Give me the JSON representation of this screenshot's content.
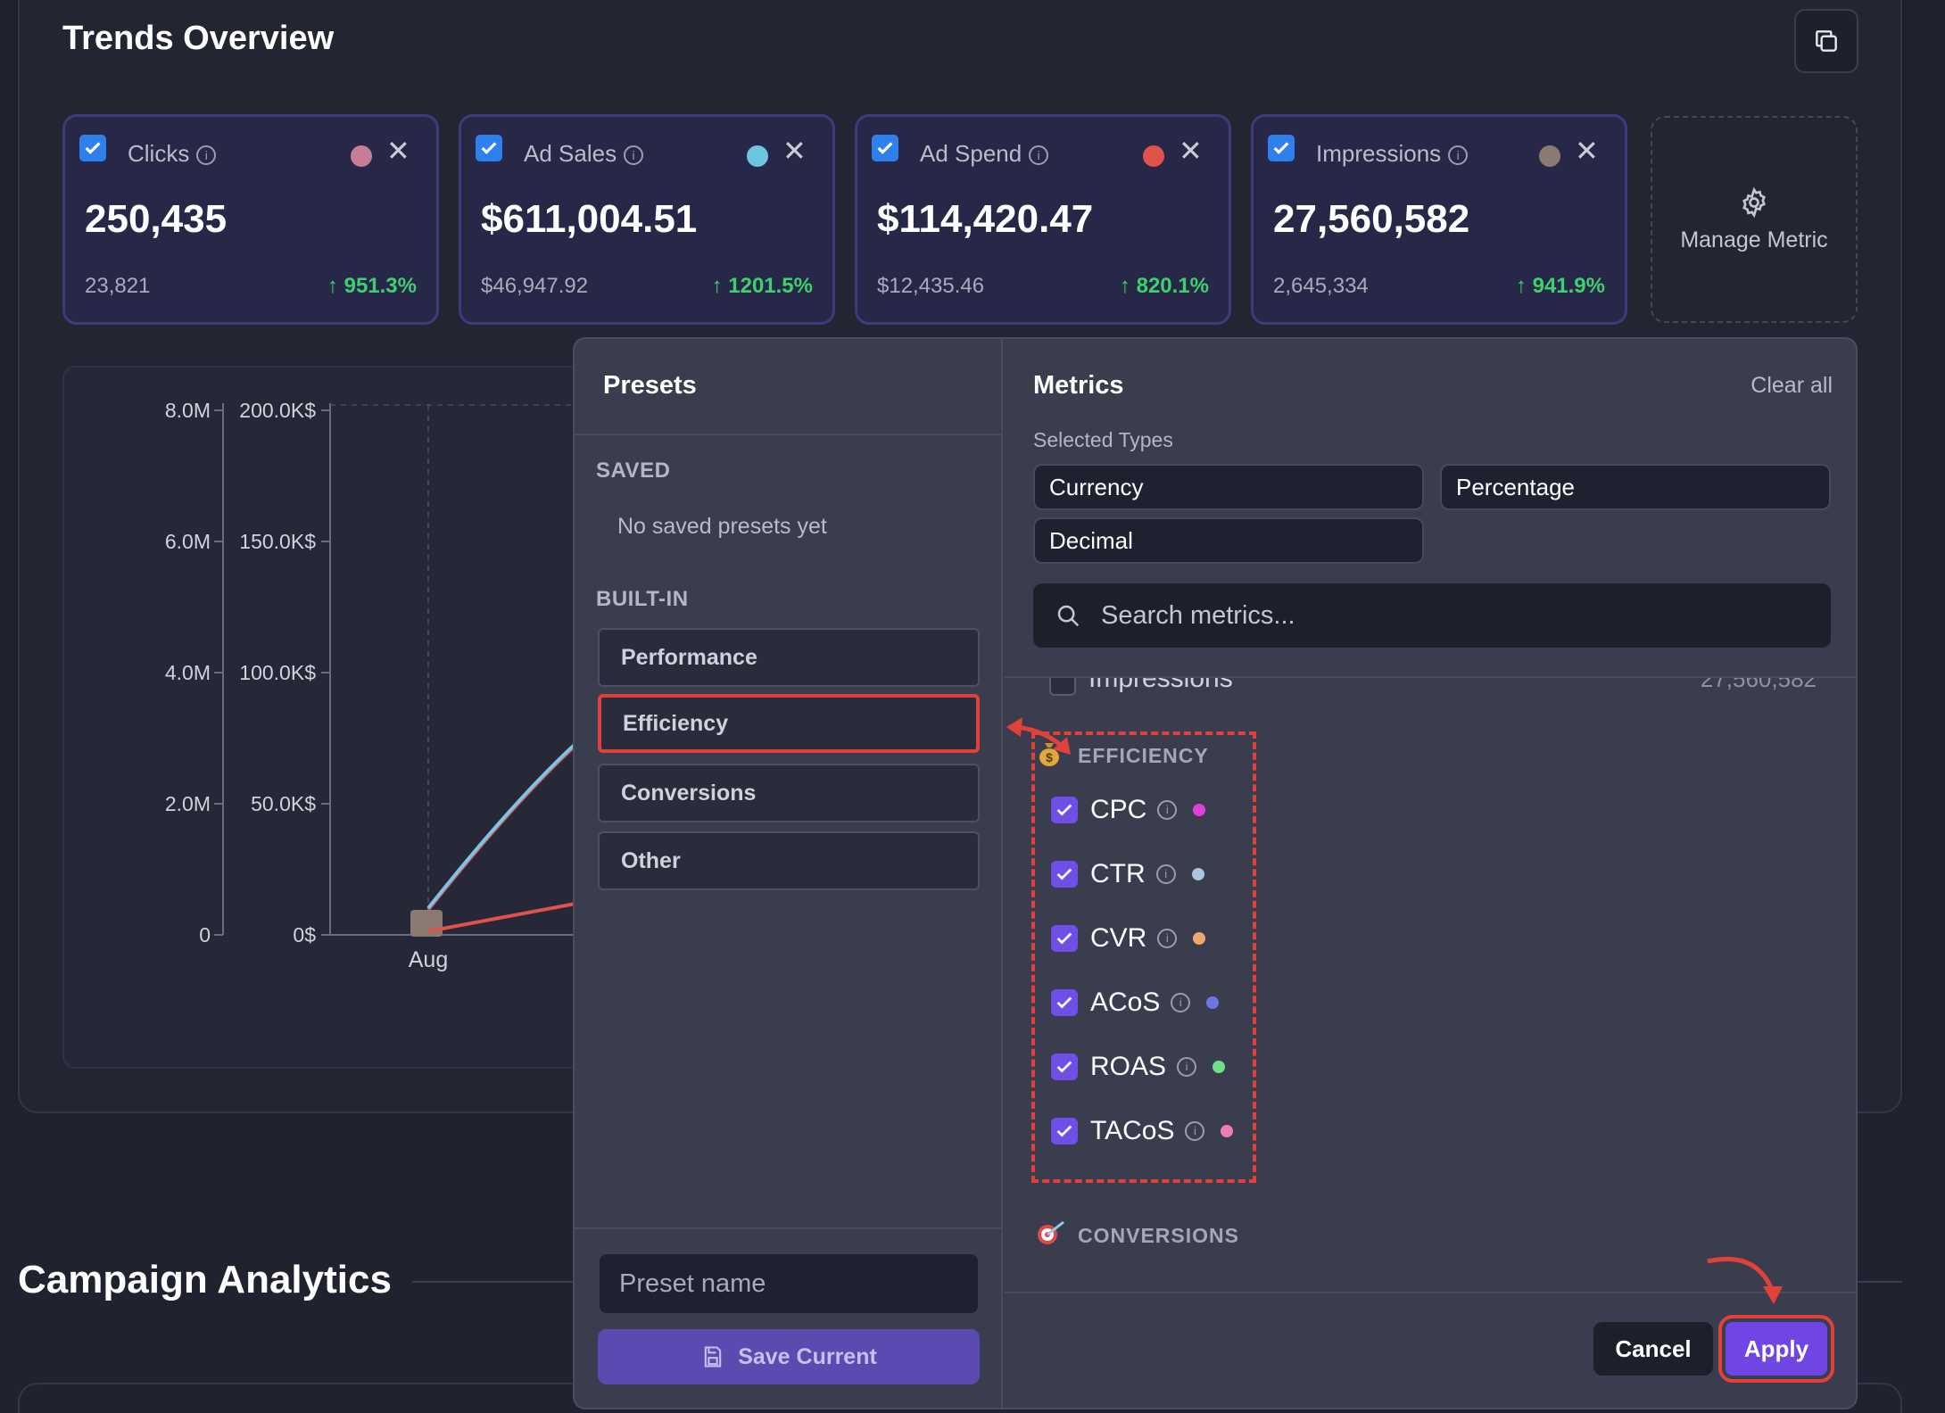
{
  "header": {
    "title": "Trends Overview"
  },
  "metric_cards": [
    {
      "label": "Clicks",
      "value": "250,435",
      "previous": "23,821",
      "change": "↑ 951.3%",
      "dot_color": "#c77d97"
    },
    {
      "label": "Ad Sales",
      "value": "$611,004.51",
      "previous": "$46,947.92",
      "change": "↑ 1201.5%",
      "dot_color": "#6cc6e0"
    },
    {
      "label": "Ad Spend",
      "value": "$114,420.47",
      "previous": "$12,435.46",
      "change": "↑ 820.1%",
      "dot_color": "#e0524a"
    },
    {
      "label": "Impressions",
      "value": "27,560,582",
      "previous": "2,645,334",
      "change": "↑ 941.9%",
      "dot_color": "#8a7a72"
    }
  ],
  "manage_metric": {
    "label": "Manage Metric"
  },
  "chart_data": {
    "type": "line",
    "categories": [
      "Aug"
    ],
    "y_left_ticks": [
      "8.0M",
      "6.0M",
      "4.0M",
      "2.0M",
      "0"
    ],
    "y_right_ticks": [
      "200.0K$",
      "150.0K$",
      "100.0K$",
      "50.0K$",
      "0$"
    ]
  },
  "presets": {
    "title": "Presets",
    "saved_label": "SAVED",
    "no_saved": "No saved presets yet",
    "builtin_label": "BUILT-IN",
    "items": [
      "Performance",
      "Efficiency",
      "Conversions",
      "Other"
    ],
    "name_placeholder": "Preset name",
    "save_label": "Save Current"
  },
  "metrics": {
    "title": "Metrics",
    "clear_all": "Clear all",
    "selected_types_label": "Selected Types",
    "types": [
      "Currency",
      "Percentage",
      "Decimal"
    ],
    "search_placeholder": "Search metrics...",
    "partial_row": {
      "label": "Impressions",
      "value": "27,560,582"
    },
    "efficiency_label": "EFFICIENCY",
    "efficiency_items": [
      {
        "label": "CPC",
        "color": "#e040d8"
      },
      {
        "label": "CTR",
        "color": "#a9c7e0"
      },
      {
        "label": "CVR",
        "color": "#f0a868"
      },
      {
        "label": "ACoS",
        "color": "#6a78e0"
      },
      {
        "label": "ROAS",
        "color": "#6ee08a"
      },
      {
        "label": "TACoS",
        "color": "#ee7fb6"
      }
    ],
    "conversions_label": "CONVERSIONS"
  },
  "footer": {
    "cancel": "Cancel",
    "apply": "Apply"
  },
  "section": {
    "campaign_title": "Campaign Analytics"
  }
}
